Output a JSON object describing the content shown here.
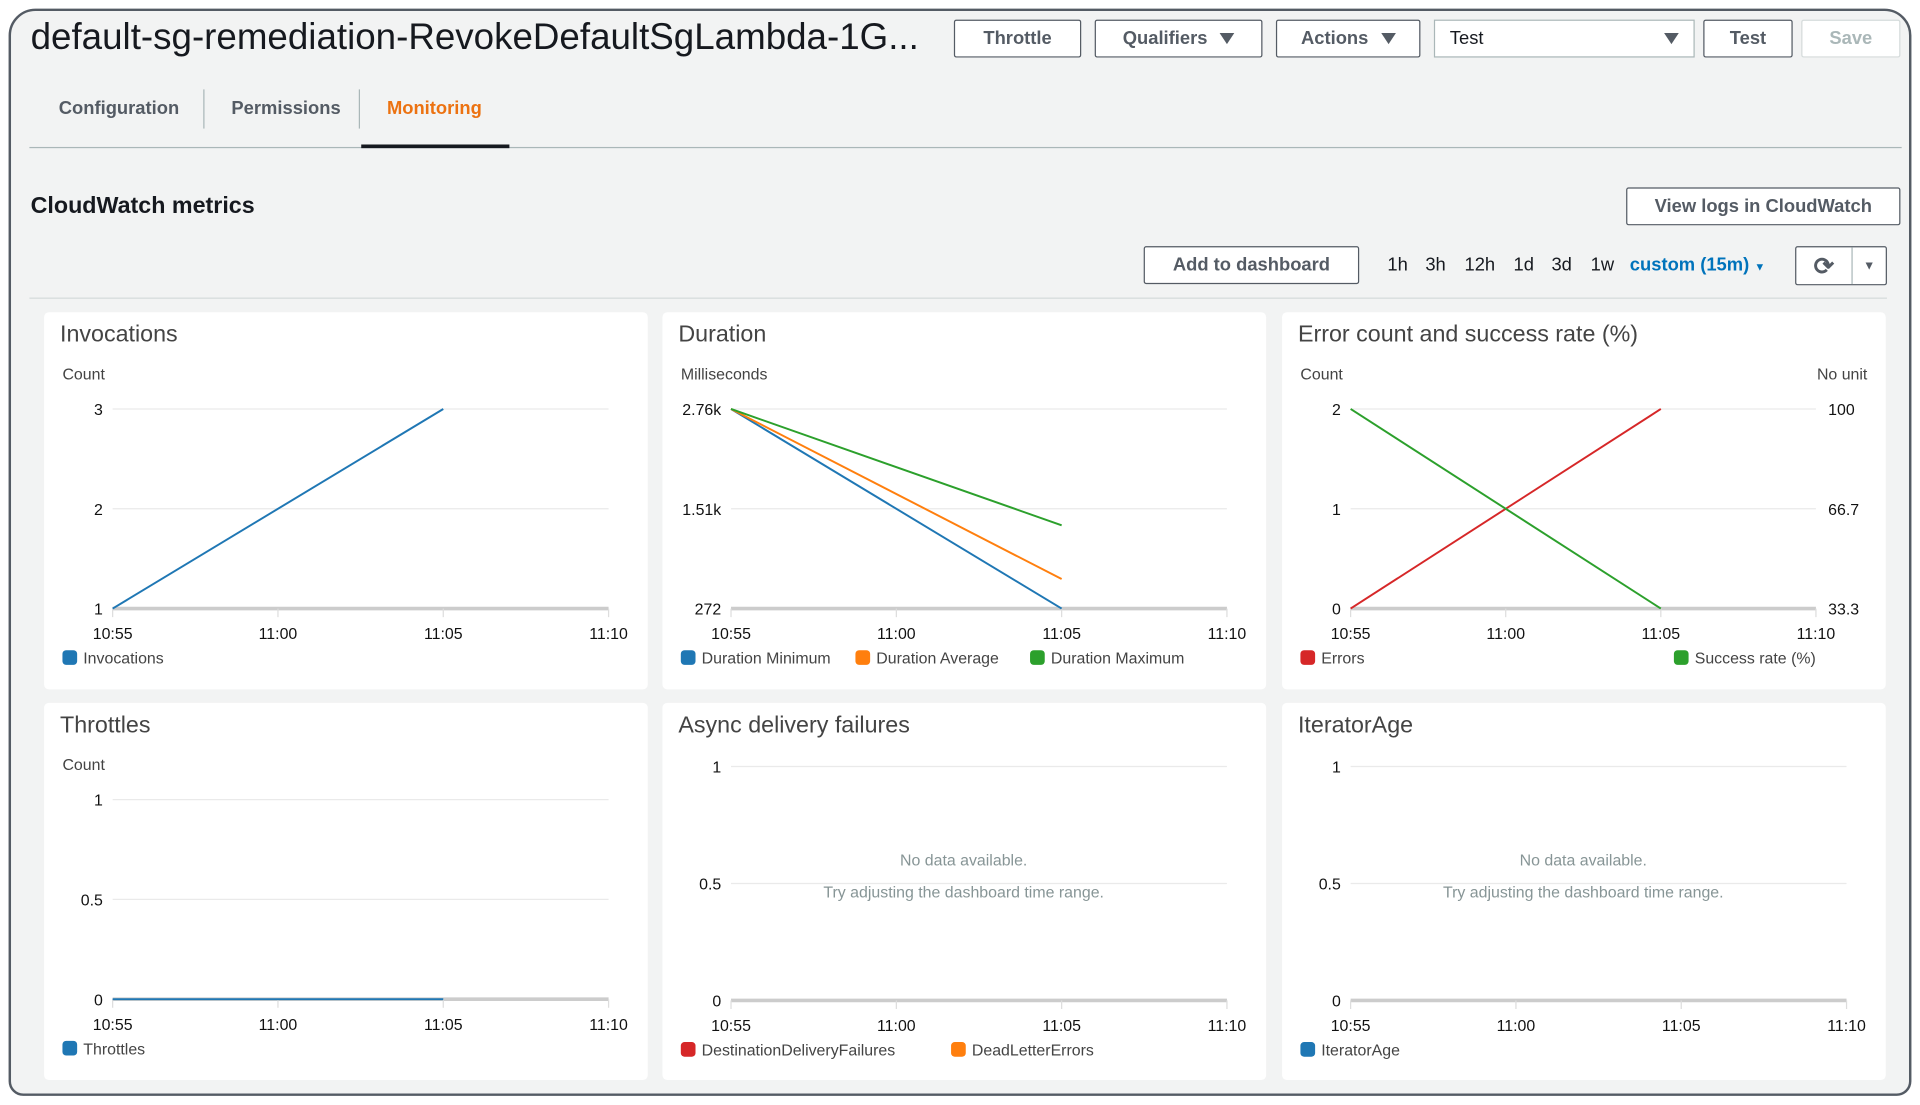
{
  "header": {
    "title": "default-sg-remediation-RevokeDefaultSgLambda-1G...",
    "throttle": "Throttle",
    "qualifiers": "Qualifiers",
    "actions": "Actions",
    "test_select": "Test",
    "test": "Test",
    "save": "Save"
  },
  "tabs": [
    {
      "label": "Configuration"
    },
    {
      "label": "Permissions"
    },
    {
      "label": "Monitoring",
      "active": true
    }
  ],
  "section": {
    "title": "CloudWatch metrics",
    "view_logs": "View logs in CloudWatch",
    "add_dashboard": "Add to dashboard",
    "ranges": [
      "1h",
      "3h",
      "12h",
      "1d",
      "3d",
      "1w"
    ],
    "custom_range": "custom (15m)",
    "accent": "#0073bb",
    "tab_accent": "#ec7211"
  },
  "chart_data": [
    {
      "type": "line",
      "title": "Invocations",
      "ylabel": "Count",
      "ylim": [
        1,
        3
      ],
      "yticks": [
        "3",
        "2",
        "1"
      ],
      "ytick_values": [
        3,
        2,
        1
      ],
      "x": [
        "10:55",
        "11:00",
        "11:05",
        "11:10"
      ],
      "grid": true,
      "legend": "bottom-left",
      "series": [
        {
          "name": "Invocations",
          "color": "#1f77b4",
          "points": [
            [
              "10:55",
              1
            ],
            [
              "11:05",
              3
            ]
          ]
        }
      ]
    },
    {
      "type": "line",
      "title": "Duration",
      "ylabel": "Milliseconds",
      "ylim": [
        272,
        2760
      ],
      "yticks": [
        "2.76k",
        "1.51k",
        "272"
      ],
      "ytick_values": [
        2760,
        1516,
        272
      ],
      "x": [
        "10:55",
        "11:00",
        "11:05",
        "11:10"
      ],
      "grid": true,
      "legend": "bottom-left",
      "series": [
        {
          "name": "Duration Minimum",
          "color": "#1f77b4",
          "points": [
            [
              "10:55",
              2760
            ],
            [
              "11:05",
              272
            ]
          ]
        },
        {
          "name": "Duration Average",
          "color": "#ff7f0e",
          "points": [
            [
              "10:55",
              2760
            ],
            [
              "11:05",
              640
            ]
          ]
        },
        {
          "name": "Duration Maximum",
          "color": "#2ca02c",
          "points": [
            [
              "10:55",
              2760
            ],
            [
              "11:05",
              1310
            ]
          ]
        }
      ]
    },
    {
      "type": "line",
      "title": "Error count and success rate (%)",
      "ylabel": "Count",
      "ylabel_right": "No unit",
      "ylim": [
        0,
        2
      ],
      "ylim_right": [
        33.3,
        100
      ],
      "yticks": [
        "2",
        "1",
        "0"
      ],
      "ytick_values": [
        2,
        1,
        0
      ],
      "yticks_right": [
        "100",
        "66.7",
        "33.3"
      ],
      "x": [
        "10:55",
        "11:00",
        "11:05",
        "11:10"
      ],
      "grid": true,
      "legend": "bottom",
      "series": [
        {
          "name": "Errors",
          "color": "#d62728",
          "axis": "left",
          "points": [
            [
              "10:55",
              0
            ],
            [
              "11:05",
              2
            ]
          ]
        },
        {
          "name": "Success rate (%)",
          "color": "#2ca02c",
          "axis": "right",
          "points": [
            [
              "10:55",
              100
            ],
            [
              "11:05",
              33.3
            ]
          ]
        }
      ]
    },
    {
      "type": "line",
      "title": "Throttles",
      "ylabel": "Count",
      "ylim": [
        0,
        1
      ],
      "yticks": [
        "1",
        "0.5",
        "0"
      ],
      "ytick_values": [
        1,
        0.5,
        0
      ],
      "x": [
        "10:55",
        "11:00",
        "11:05",
        "11:10"
      ],
      "grid": true,
      "legend": "bottom-left",
      "series": [
        {
          "name": "Throttles",
          "color": "#1f77b4",
          "points": [
            [
              "10:55",
              0
            ],
            [
              "11:05",
              0
            ]
          ]
        }
      ]
    },
    {
      "type": "line",
      "title": "Async delivery failures",
      "ylabel": "",
      "ylim": [
        0,
        1
      ],
      "yticks": [
        "1",
        "0.5",
        "0"
      ],
      "ytick_values": [
        1,
        0.5,
        0
      ],
      "x": [
        "10:55",
        "11:00",
        "11:05",
        "11:10"
      ],
      "grid": true,
      "legend": "bottom-left",
      "no_data": "No data available.",
      "no_data_hint": "Try adjusting the dashboard time range.",
      "series": [
        {
          "name": "DestinationDeliveryFailures",
          "color": "#d62728",
          "points": []
        },
        {
          "name": "DeadLetterErrors",
          "color": "#ff7f0e",
          "points": []
        }
      ]
    },
    {
      "type": "line",
      "title": "IteratorAge",
      "ylabel": "",
      "ylim": [
        0,
        1
      ],
      "yticks": [
        "1",
        "0.5",
        "0"
      ],
      "ytick_values": [
        1,
        0.5,
        0
      ],
      "x": [
        "10:55",
        "11:00",
        "11:05",
        "11:10"
      ],
      "grid": true,
      "legend": "bottom-left",
      "no_data": "No data available.",
      "no_data_hint": "Try adjusting the dashboard time range.",
      "series": [
        {
          "name": "IteratorAge",
          "color": "#1f77b4",
          "points": []
        }
      ]
    }
  ]
}
